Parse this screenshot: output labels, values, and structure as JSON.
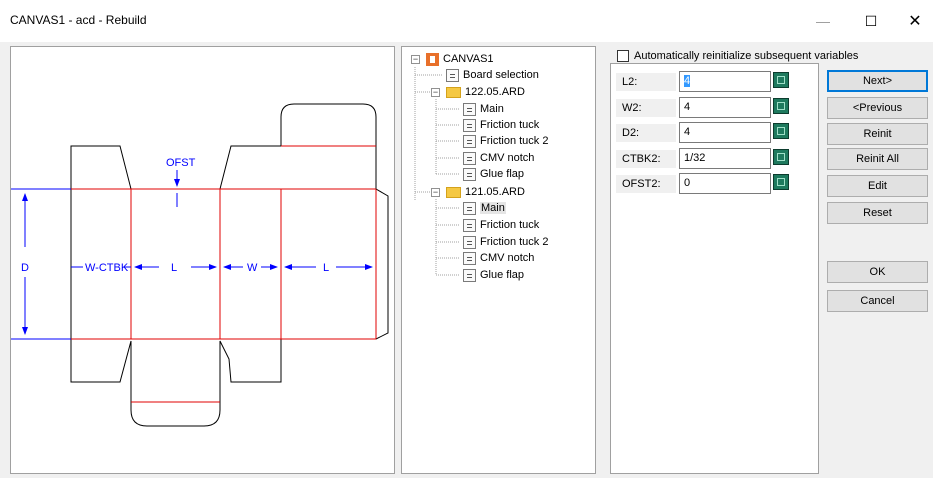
{
  "window": {
    "title": "CANVAS1 - acd - Rebuild",
    "min_glyph": "—",
    "max_glyph": "☐",
    "close_glyph": "✕"
  },
  "drawing": {
    "labels": {
      "ofst": "OFST",
      "d": "D",
      "w_ctbk": "W-CTBK",
      "l1": "L",
      "w": "W",
      "l2": "L"
    }
  },
  "tree": {
    "root": "CANVAS1",
    "board_selection": "Board selection",
    "groups": [
      {
        "name": "122.05.ARD",
        "items": [
          "Main",
          "Friction tuck",
          "Friction tuck 2",
          "CMV notch",
          "Glue flap"
        ]
      },
      {
        "name": "121.05.ARD",
        "items": [
          "Main",
          "Friction tuck",
          "Friction tuck 2",
          "CMV notch",
          "Glue flap"
        ]
      }
    ]
  },
  "options": {
    "auto_reinit_label": "Automatically reinitialize subsequent variables",
    "auto_reinit_checked": false
  },
  "variables": [
    {
      "label": "L2:",
      "value": "4"
    },
    {
      "label": "W2:",
      "value": "4"
    },
    {
      "label": "D2:",
      "value": "4"
    },
    {
      "label": "CTBK2:",
      "value": "1/32"
    },
    {
      "label": "OFST2:",
      "value": "0"
    }
  ],
  "buttons": {
    "next": "Next>",
    "previous": "<Previous",
    "reinit": "Reinit",
    "reinit_all": "Reinit All",
    "edit": "Edit",
    "reset": "Reset",
    "ok": "OK",
    "cancel": "Cancel"
  },
  "colors": {
    "cut_line": "#000000",
    "crease_line": "#e00000",
    "dimension": "#0000ff",
    "canvas_icon": "#e8702a",
    "folder_icon": "#f5c842",
    "default_button_border": "#0078d7"
  }
}
